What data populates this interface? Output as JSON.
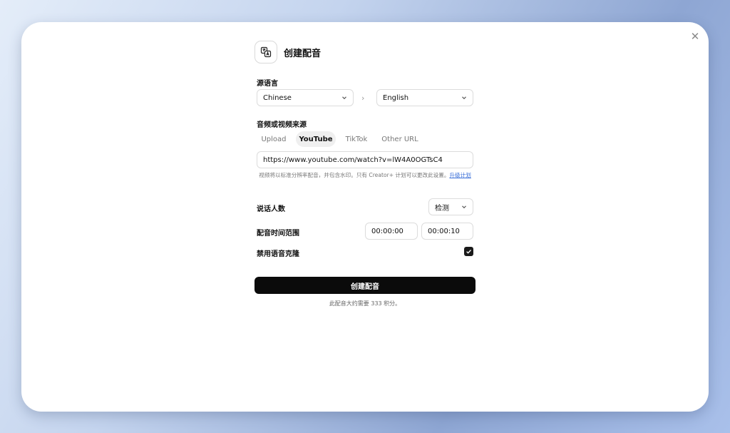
{
  "dialog": {
    "title": "创建配音",
    "close_icon": "close-icon",
    "header_icon": "translate-icon"
  },
  "source_language": {
    "label": "源语言",
    "value": "Chinese"
  },
  "target_language": {
    "value": "English"
  },
  "media_source": {
    "label": "音频或视频来源",
    "tabs": [
      {
        "label": "Upload",
        "active": false
      },
      {
        "label": "YouTube",
        "active": true
      },
      {
        "label": "TikTok",
        "active": false
      },
      {
        "label": "Other URL",
        "active": false
      }
    ],
    "url_value": "https://www.youtube.com/watch?v=lW4A0OGTsC4",
    "hint_text": "视频将以标准分辨率配音，并包含水印。只有 Creator+ 计划可以更改此设置。",
    "hint_link": "升级计划"
  },
  "speakers": {
    "label": "说话人数",
    "value": "检测"
  },
  "time_range": {
    "label": "配音时间范围",
    "start": "00:00:00",
    "end": "00:00:10"
  },
  "disable_voice_clone": {
    "label": "禁用语音克隆",
    "checked": true
  },
  "submit": {
    "label": "创建配音",
    "credits_text": "此配音大约需要 333 积分。"
  },
  "colors": {
    "primary_button": "#0b0b0b",
    "link": "#3a6fd8",
    "active_tab_bg": "#efefef"
  }
}
